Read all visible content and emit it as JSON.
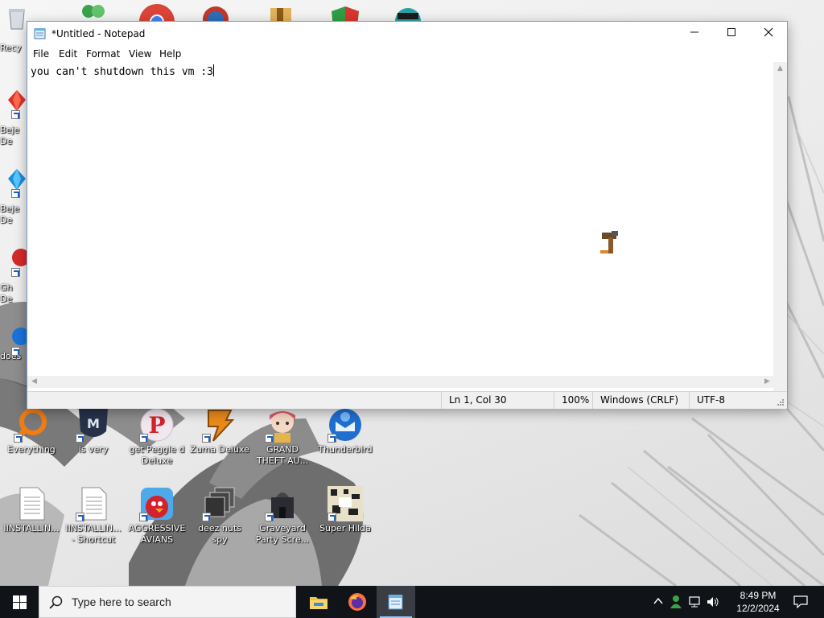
{
  "desktop": {
    "icons": [
      {
        "label": "Everything"
      },
      {
        "label": "is very"
      },
      {
        "label": "get Peggle d Deluxe"
      },
      {
        "label": "Zuma Deluxe"
      },
      {
        "label": "GRAND THEFT AU..."
      },
      {
        "label": "Thunderbird"
      },
      {
        "label": "IINSTALLIN..."
      },
      {
        "label": "IINSTALLIN... - Shortcut"
      },
      {
        "label": "AGGRESSIVE AVIANS"
      },
      {
        "label": "deez nuts spy"
      },
      {
        "label": "Graveyard Party Scre..."
      },
      {
        "label": "Super Hilda"
      }
    ],
    "left_edge_labels": [
      "Recy",
      "Beje De",
      "Beje De",
      "Gh De",
      "does"
    ]
  },
  "notepad": {
    "title": "*Untitled - Notepad",
    "menu": [
      "File",
      "Edit",
      "Format",
      "View",
      "Help"
    ],
    "content": "you can't shutdown this vm :3",
    "status": {
      "position": "Ln 1, Col 30",
      "zoom": "100%",
      "line_ending": "Windows (CRLF)",
      "encoding": "UTF-8"
    }
  },
  "taskbar": {
    "search_placeholder": "Type here to search",
    "time": "8:49 PM",
    "date": "12/2/2024"
  }
}
